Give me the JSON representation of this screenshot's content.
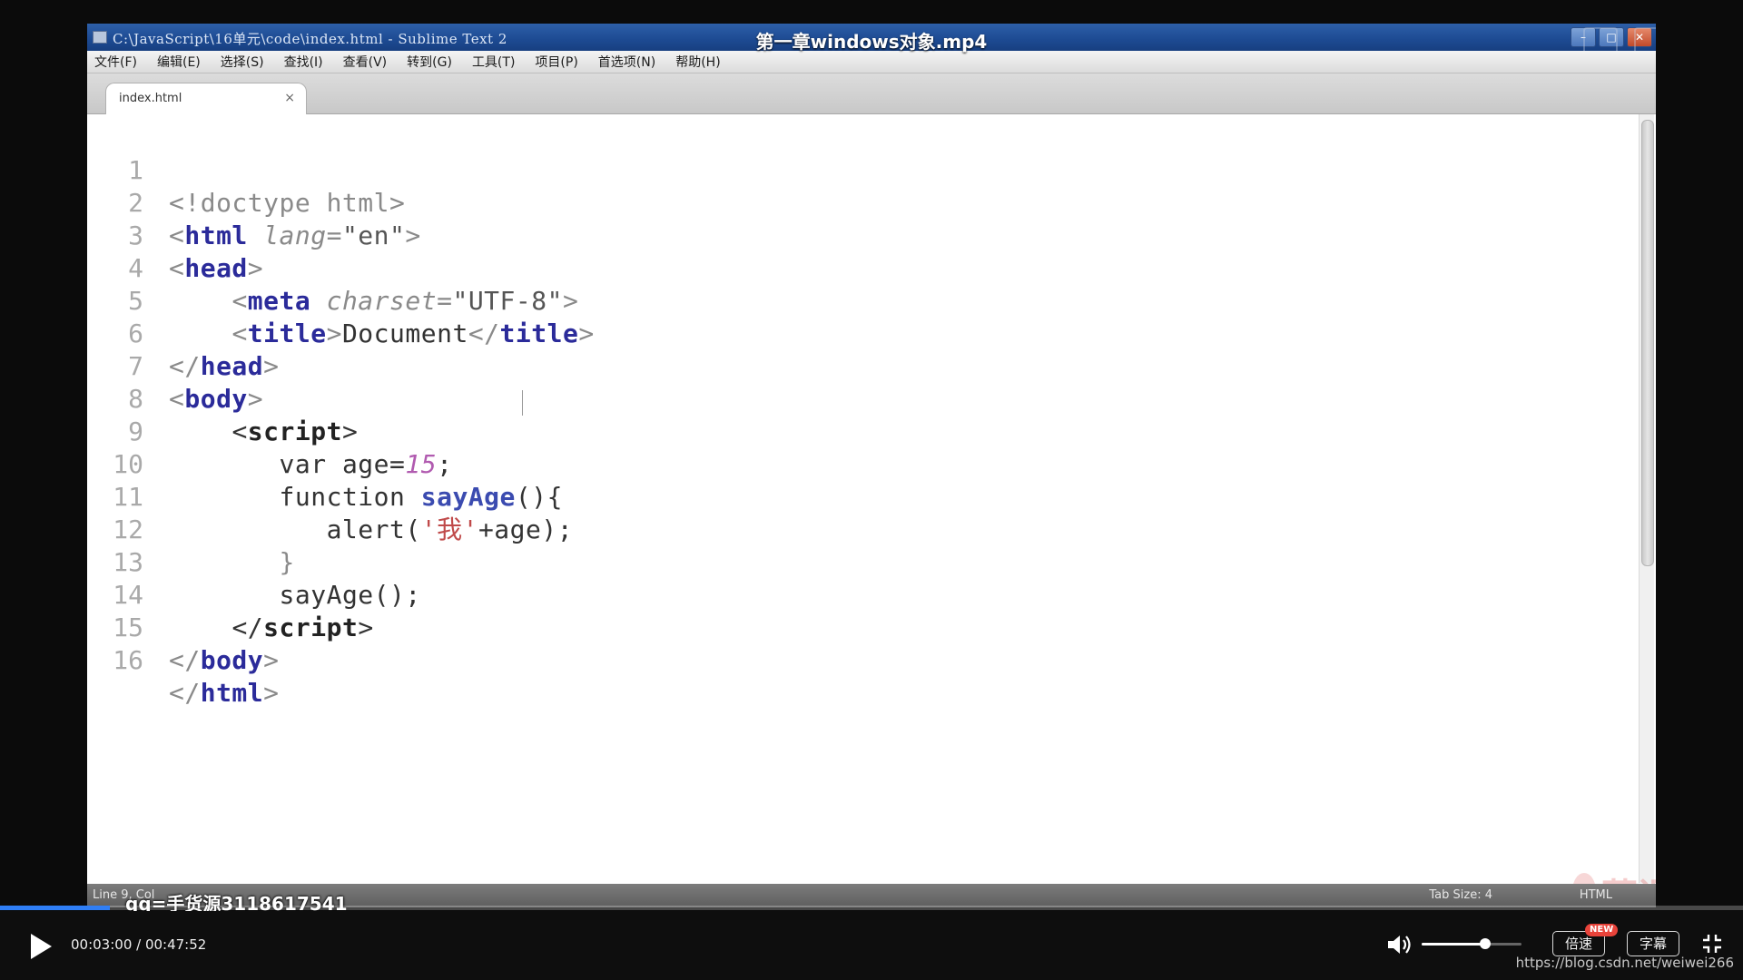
{
  "video": {
    "title": "第一章windows对象.mp4",
    "qq_overlay": "qq=手货源3118617541",
    "watermark": "慕课网"
  },
  "editor_window": {
    "title": "C:\\JavaScript\\16单元\\code\\index.html - Sublime Text 2",
    "menu": [
      "文件(F)",
      "编辑(E)",
      "选择(S)",
      "查找(I)",
      "查看(V)",
      "转到(G)",
      "工具(T)",
      "项目(P)",
      "首选项(N)",
      "帮助(H)"
    ],
    "tab": {
      "label": "index.html",
      "close": "×"
    },
    "status": {
      "left": "Line 9, Col",
      "tab_size": "Tab Size: 4",
      "syntax": "HTML"
    },
    "code_lines": [
      "1",
      "2",
      "3",
      "4",
      "5",
      "6",
      "7",
      "8",
      "9",
      "10",
      "11",
      "12",
      "13",
      "14",
      "15",
      "16"
    ]
  },
  "player": {
    "time": "00:03:00 / 00:47:52",
    "progress": 0.063,
    "volume": 0.64,
    "speed_label": "倍速",
    "new_badge": "NEW",
    "subtitle_label": "字幕",
    "icons": {
      "play": "play-icon",
      "volume": "volume-icon",
      "fullscreen": "exit-fullscreen-icon"
    }
  },
  "source_url": "https://blog.csdn.net/weiwei266",
  "code": {
    "l1": "<!doctype html>",
    "l2_tag": "html",
    "l2_attr": "lang",
    "l2_val": "\"en\"",
    "l3_tag": "head",
    "l4_tag": "meta",
    "l4_attr": "charset",
    "l4_val": "\"UTF-8\"",
    "l5_tag": "title",
    "l5_text": "Document",
    "l6_tag": "head",
    "l7_tag": "body",
    "l8_tag": "script",
    "l9_kw": "var age=",
    "l9_num": "15",
    "l9_end": ";",
    "l10_kw": "function ",
    "l10_fn": "sayAge",
    "l10_end": "(){",
    "l11_call": "alert(",
    "l11_str": "'我'",
    "l11_end": "+age);",
    "l12": "}",
    "l13": "sayAge();",
    "l14_tag": "script",
    "l15_tag": "body",
    "l16_tag": "html"
  }
}
